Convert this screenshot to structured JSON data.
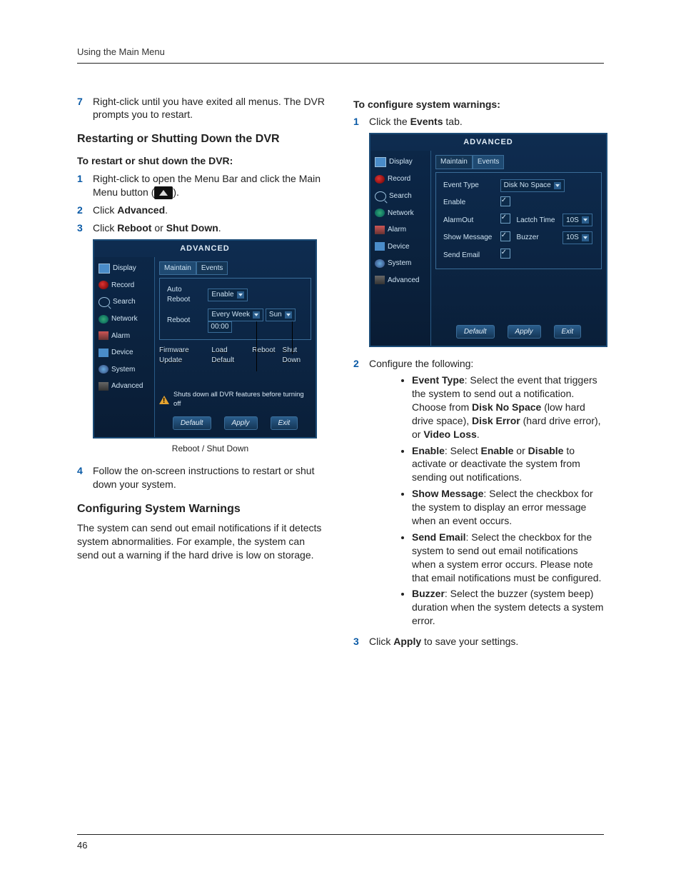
{
  "running_head": "Using the Main Menu",
  "page_number": "46",
  "left": {
    "step7": "Right-click until you have exited all menus. The DVR prompts you to restart.",
    "h_restart": "Restarting or Shutting Down the DVR",
    "sub_restart": "To restart or shut down the DVR:",
    "step1_a": "Right-click to open the Menu Bar and click the Main Menu button (",
    "step1_b": ").",
    "step2_a": "Click ",
    "step2_b": "Advanced",
    "step2_c": ".",
    "step3_a": "Click ",
    "step3_b": "Reboot",
    "step3_c": " or ",
    "step3_d": "Shut Down",
    "step3_e": ".",
    "caption1": "Reboot / Shut Down",
    "step4": "Follow the on-screen instructions to restart or shut down your system.",
    "h_warn": "Configuring System Warnings",
    "warn_para": "The system can send out email notifications if it detects system abnormalities. For example, the system can send out a warning if the hard drive is low on storage."
  },
  "right": {
    "sub_cfg": "To configure system warnings:",
    "step1_a": "Click the ",
    "step1_b": "Events",
    "step1_c": " tab.",
    "step2": "Configure the following:",
    "b_et_a": "Event Type",
    "b_et_b": ": Select the event that triggers the system to send out a notification. Choose from ",
    "b_et_c": "Disk No Space",
    "b_et_d": " (low hard drive space), ",
    "b_et_e": "Disk Error",
    "b_et_f": " (hard drive error), or ",
    "b_et_g": "Video Loss",
    "b_et_h": ".",
    "b_en_a": "Enable",
    "b_en_b": ": Select ",
    "b_en_c": "Enable",
    "b_en_d": " or ",
    "b_en_e": "Disable",
    "b_en_f": " to activate or deactivate the system from sending out notifications.",
    "b_sm_a": "Show Message",
    "b_sm_b": ": Select the checkbox for the system to display an error message when an event occurs.",
    "b_se_a": "Send Email",
    "b_se_b": ": Select the checkbox for the system to send out email notifications when a system error occurs. Please note that email notifications must be configured.",
    "b_bz_a": "Buzzer",
    "b_bz_b": ": Select the buzzer (system beep) duration when the system detects a system error.",
    "step3_a": "Click ",
    "step3_b": "Apply",
    "step3_c": " to save your settings."
  },
  "dvr": {
    "title": "ADVANCED",
    "side": [
      "Display",
      "Record",
      "Search",
      "Network",
      "Alarm",
      "Device",
      "System",
      "Advanced"
    ],
    "tabs": {
      "maintain": "Maintain",
      "events": "Events"
    },
    "maintain": {
      "auto_reboot": "Auto Reboot",
      "enable": "Enable",
      "reboot": "Reboot",
      "every_week": "Every Week",
      "sun": "Sun",
      "time": "00:00",
      "links": [
        "Firmware Update",
        "Load Default",
        "Reboot",
        "Shut Down"
      ],
      "warn": "Shuts down all DVR features before turning off"
    },
    "events": {
      "event_type_lbl": "Event Type",
      "event_type_val": "Disk No Space",
      "enable": "Enable",
      "alarm_out": "AlarmOut",
      "latch": "Lactch Time",
      "latch_val": "10S",
      "show_msg": "Show Message",
      "buzzer": "Buzzer",
      "buzzer_val": "10S",
      "send_email": "Send Email"
    },
    "buttons": {
      "default": "Default",
      "apply": "Apply",
      "exit": "Exit"
    }
  }
}
